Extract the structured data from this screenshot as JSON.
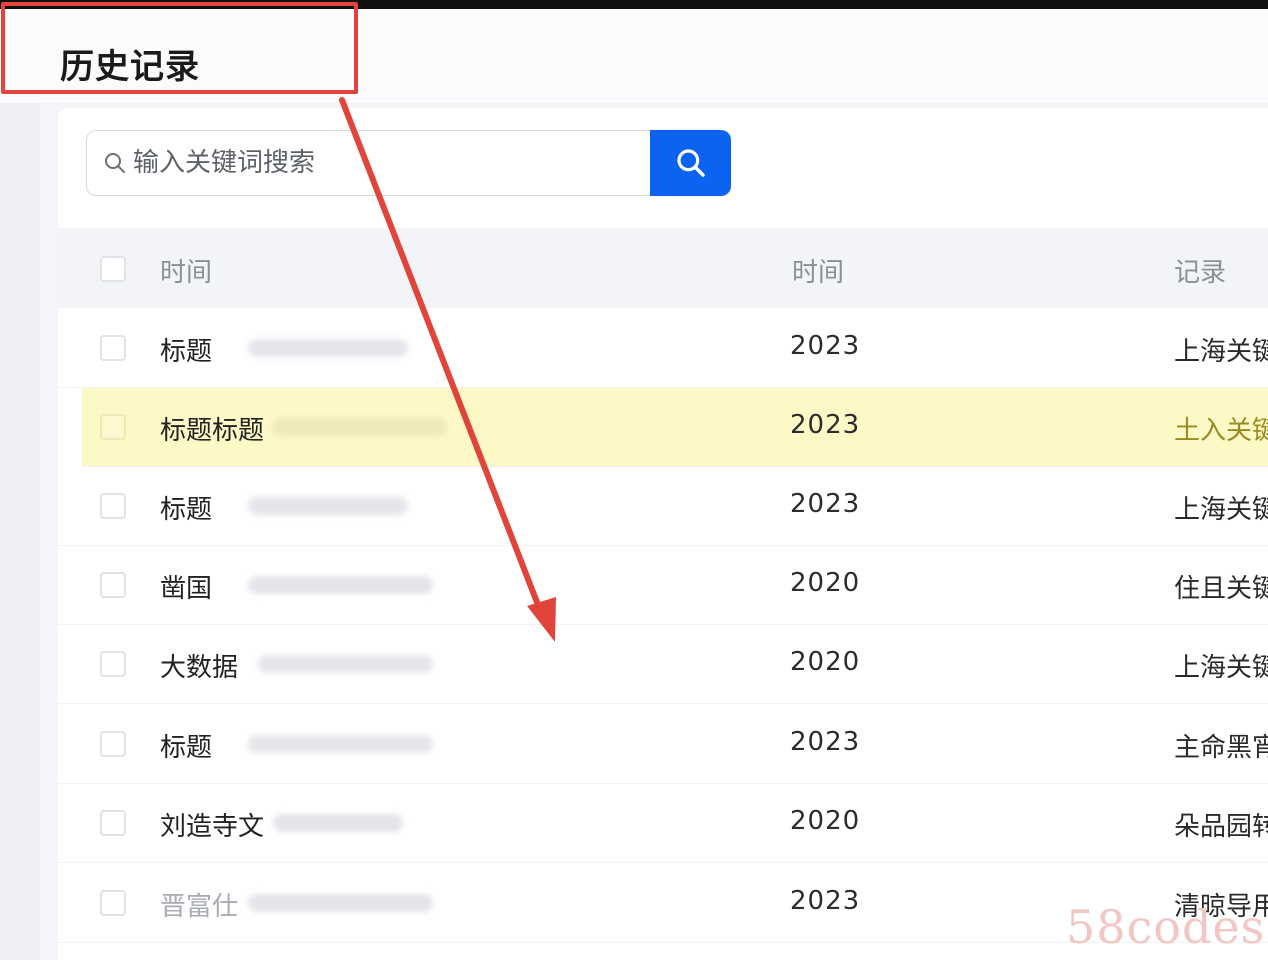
{
  "header": {
    "title": "历史记录"
  },
  "search": {
    "placeholder": "输入关键词搜索"
  },
  "table": {
    "columns": [
      "时间",
      "时间",
      "记录"
    ],
    "rows": [
      {
        "name": "标题",
        "year": "2023",
        "record": "上海关键"
      },
      {
        "name": "标题标题",
        "year": "2023",
        "record": "土入关键",
        "highlighted": true
      },
      {
        "name": "标题",
        "year": "2023",
        "record": "上海关键"
      },
      {
        "name": "凿国",
        "year": "2020",
        "record": "住且关键"
      },
      {
        "name": "大数据",
        "year": "2020",
        "record": "上海关键"
      },
      {
        "name": "标题",
        "year": "2023",
        "record": "主命黑宵"
      },
      {
        "name": "刘造寺文",
        "year": "2020",
        "record": "朵品园转"
      },
      {
        "name": "晋富仕",
        "year": "2023",
        "record": "清晾导用"
      }
    ]
  },
  "watermark": "58codes",
  "colors": {
    "accent": "#0b63f0",
    "highlight_row": "#fdf9c6",
    "annotation_red": "#e0443a"
  },
  "icons": {
    "search_small": "search-icon",
    "search_button": "search-icon"
  }
}
